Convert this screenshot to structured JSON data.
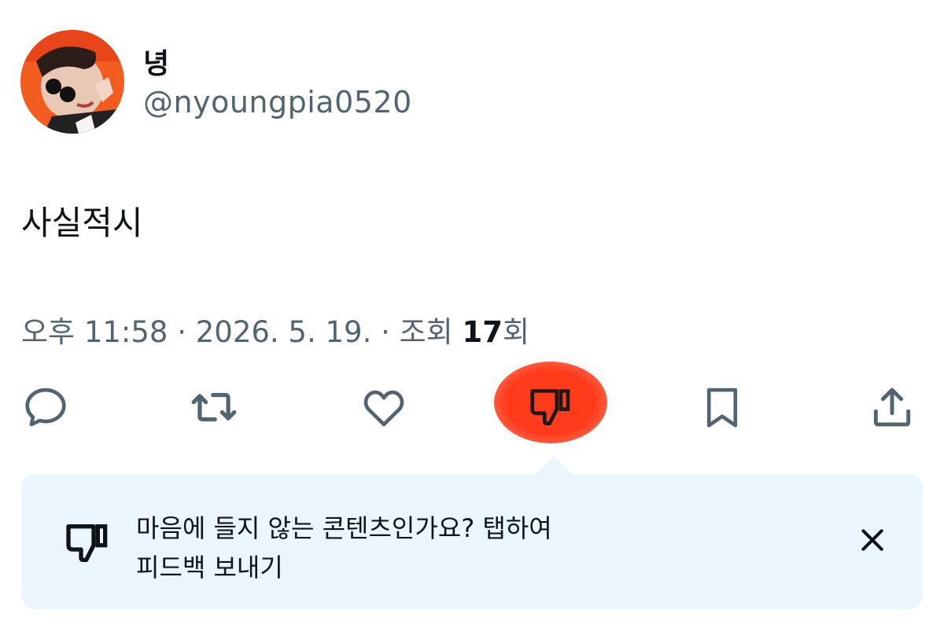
{
  "post": {
    "display_name": "녕",
    "handle": "@nyoungpia0520",
    "text": "사실적시",
    "meta_prefix": "오후 11:58 · 2026. 5. 19. · 조회 ",
    "views": "17",
    "views_suffix": "회"
  },
  "actions": {
    "icons": [
      "reply-icon",
      "repost-icon",
      "like-icon",
      "dislike-icon",
      "bookmark-icon",
      "share-icon"
    ],
    "highlight_color": "#ff3b1a"
  },
  "tooltip": {
    "line1": "마음에 들지 않는 콘텐츠인가요? 탭하여",
    "line2": "피드백 보내기",
    "background": "#eaf5fd"
  },
  "colors": {
    "text": "#0f1419",
    "secondary": "#536471",
    "icon": "#536471"
  }
}
